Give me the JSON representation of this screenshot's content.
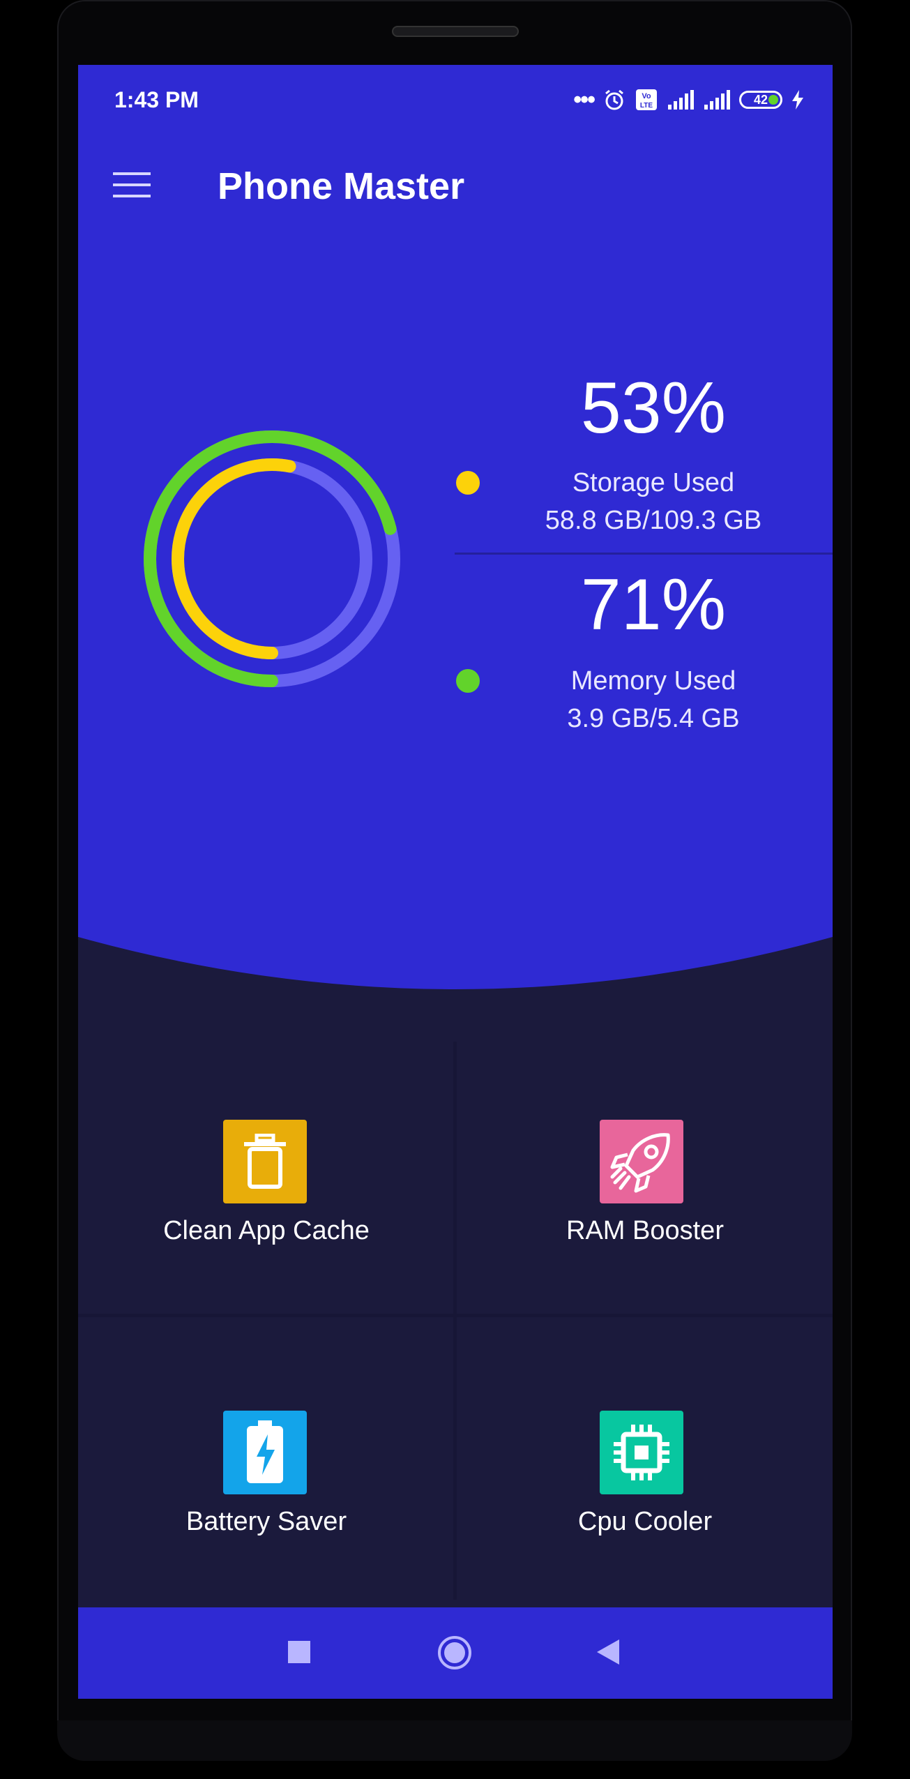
{
  "status_bar": {
    "time": "1:43 PM",
    "battery_level": "42",
    "icons": [
      "more-dots-icon",
      "alarm-icon",
      "volte-icon",
      "signal-icon",
      "signal-icon",
      "battery-icon",
      "charging-icon"
    ]
  },
  "app_bar": {
    "title": "Phone Master",
    "menu_icon": "hamburger-menu-icon"
  },
  "storage": {
    "percent": "53%",
    "label": "Storage Used",
    "value": "58.8 GB/109.3 GB",
    "fraction": 0.53,
    "color": "#fcd20a"
  },
  "memory": {
    "percent": "71%",
    "label": "Memory Used",
    "value": "3.9 GB/5.4 GB",
    "fraction": 0.71,
    "color": "#62d32b"
  },
  "colors": {
    "primary": "#2f2ad3",
    "track": "#6661f2",
    "grid_bg": "#1b1a3c",
    "clean_tile": "#e8ad0a",
    "ram_tile": "#e8669b",
    "battery_tile": "#13a4ea",
    "cpu_tile": "#08c7a0"
  },
  "tools": [
    {
      "label": "Clean App Cache",
      "icon": "trash-icon"
    },
    {
      "label": "RAM Booster",
      "icon": "rocket-icon"
    },
    {
      "label": "Battery Saver",
      "icon": "battery-bolt-icon"
    },
    {
      "label": "Cpu Cooler",
      "icon": "cpu-chip-icon"
    }
  ],
  "nav": [
    "recents-square-icon",
    "home-circle-icon",
    "back-triangle-icon"
  ]
}
